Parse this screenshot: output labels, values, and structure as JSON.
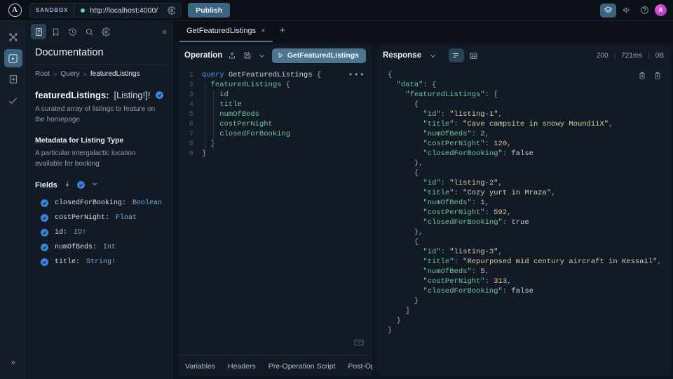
{
  "topbar": {
    "logo": "A",
    "env_chip": "SANDBOX",
    "url": "http://localhost:4000/",
    "publish_label": "Publish",
    "status_color": "#5fd39a",
    "accent_color": "#3c6480",
    "icons": {
      "settings": "gear-icon",
      "eye": "preview-icon",
      "megaphone": "announcements-icon",
      "help": "help-icon"
    },
    "avatar_initial": "A"
  },
  "rail": {
    "items": [
      {
        "name": "graph-icon",
        "active": false
      },
      {
        "name": "explorer-icon",
        "active": true
      },
      {
        "name": "schema-icon",
        "active": false
      },
      {
        "name": "checks-icon",
        "active": false
      }
    ],
    "expand_label": "»"
  },
  "docs": {
    "toolbar": [
      {
        "name": "documentation-icon",
        "active": true
      },
      {
        "name": "bookmark-icon",
        "active": false
      },
      {
        "name": "history-icon",
        "active": false
      },
      {
        "name": "search-icon",
        "active": false
      },
      {
        "name": "settings-icon",
        "active": false
      }
    ],
    "collapse_label": "«",
    "title": "Documentation",
    "breadcrumb": {
      "root": "Root",
      "query": "Query",
      "current": "featuredListings",
      "separator": ">"
    },
    "signature_name": "featuredListings:",
    "signature_type": "[Listing!]!",
    "description": "A curated array of listings to feature on the homepage",
    "metadata_heading": "Metadata for Listing Type",
    "metadata_description": "A particular intergalactic location available for booking",
    "fields_label": "Fields",
    "fields_sort_icon": "arrow-down-icon",
    "fields_chevron": "chevron-down-icon",
    "fields": [
      {
        "name": "closedForBooking:",
        "type": "Boolean"
      },
      {
        "name": "costPerNight:",
        "type": "Float"
      },
      {
        "name": "id:",
        "type": "ID!"
      },
      {
        "name": "numOfBeds:",
        "type": "Int"
      },
      {
        "name": "title:",
        "type": "String!"
      }
    ]
  },
  "tabs": {
    "items": [
      {
        "label": "GetFeaturedListings",
        "close": "×",
        "active": true
      }
    ],
    "new_tab": "+"
  },
  "operation": {
    "title": "Operation",
    "icons": {
      "share": "share-icon",
      "save": "save-icon",
      "chevron": "chevron-down-icon",
      "more": "•••",
      "keyboard": "keyboard-shortcuts-icon"
    },
    "run_label": "GetFeaturedListings",
    "run_icon": "play-icon",
    "lines": [
      {
        "num": "1",
        "segments": [
          {
            "t": "query ",
            "c": "kw"
          },
          {
            "t": "GetFeaturedListings ",
            "c": "fn"
          },
          {
            "t": "{",
            "c": "pun"
          }
        ]
      },
      {
        "num": "2",
        "segments": [
          {
            "t": "  ",
            "c": "pun"
          },
          {
            "t": "featuredListings ",
            "c": "fld"
          },
          {
            "t": "{",
            "c": "pun"
          }
        ]
      },
      {
        "num": "3",
        "segments": [
          {
            "t": "    ",
            "c": "pun"
          },
          {
            "t": "id",
            "c": "fld"
          }
        ]
      },
      {
        "num": "4",
        "segments": [
          {
            "t": "    ",
            "c": "pun"
          },
          {
            "t": "title",
            "c": "fld"
          }
        ]
      },
      {
        "num": "5",
        "segments": [
          {
            "t": "    ",
            "c": "pun"
          },
          {
            "t": "numOfBeds",
            "c": "fld"
          }
        ]
      },
      {
        "num": "6",
        "segments": [
          {
            "t": "    ",
            "c": "pun"
          },
          {
            "t": "costPerNight",
            "c": "fld"
          }
        ]
      },
      {
        "num": "7",
        "segments": [
          {
            "t": "    ",
            "c": "pun"
          },
          {
            "t": "closedForBooking",
            "c": "fld"
          }
        ]
      },
      {
        "num": "8",
        "segments": [
          {
            "t": "  }",
            "c": "pun"
          }
        ]
      },
      {
        "num": "9",
        "segments": [
          {
            "t": "}",
            "c": "pun"
          }
        ]
      }
    ],
    "bottom_tabs": [
      "Variables",
      "Headers",
      "Pre-Operation Script",
      "Post-Ope"
    ]
  },
  "response": {
    "title": "Response",
    "chevron": "chevron-down-icon",
    "view_modes": [
      {
        "name": "json-view-icon",
        "active": true
      },
      {
        "name": "table-view-icon",
        "active": false
      }
    ],
    "status": "200",
    "time": "721ms",
    "size": "0B",
    "actions": [
      "copy-icon",
      "download-icon"
    ],
    "lines": [
      {
        "segments": [
          {
            "t": "{",
            "c": "p"
          }
        ]
      },
      {
        "segments": [
          {
            "t": "  ",
            "c": "p"
          },
          {
            "t": "\"data\"",
            "c": "k"
          },
          {
            "t": ": {",
            "c": "p"
          }
        ]
      },
      {
        "segments": [
          {
            "t": "    ",
            "c": "p"
          },
          {
            "t": "\"featuredListings\"",
            "c": "k"
          },
          {
            "t": ": [",
            "c": "p"
          }
        ]
      },
      {
        "segments": [
          {
            "t": "      {",
            "c": "p"
          }
        ]
      },
      {
        "segments": [
          {
            "t": "        ",
            "c": "p"
          },
          {
            "t": "\"id\"",
            "c": "k"
          },
          {
            "t": ": ",
            "c": "p"
          },
          {
            "t": "\"listing-1\"",
            "c": "s"
          },
          {
            "t": ",",
            "c": "p"
          }
        ]
      },
      {
        "segments": [
          {
            "t": "        ",
            "c": "p"
          },
          {
            "t": "\"title\"",
            "c": "k"
          },
          {
            "t": ": ",
            "c": "p"
          },
          {
            "t": "\"Cave campsite in snowy MoundiiX\"",
            "c": "s"
          },
          {
            "t": ",",
            "c": "p"
          }
        ]
      },
      {
        "segments": [
          {
            "t": "        ",
            "c": "p"
          },
          {
            "t": "\"numOfBeds\"",
            "c": "k"
          },
          {
            "t": ": ",
            "c": "p"
          },
          {
            "t": "2",
            "c": "n"
          },
          {
            "t": ",",
            "c": "p"
          }
        ]
      },
      {
        "segments": [
          {
            "t": "        ",
            "c": "p"
          },
          {
            "t": "\"costPerNight\"",
            "c": "k"
          },
          {
            "t": ": ",
            "c": "p"
          },
          {
            "t": "120",
            "c": "n"
          },
          {
            "t": ",",
            "c": "p"
          }
        ]
      },
      {
        "segments": [
          {
            "t": "        ",
            "c": "p"
          },
          {
            "t": "\"closedForBooking\"",
            "c": "k"
          },
          {
            "t": ": ",
            "c": "p"
          },
          {
            "t": "false",
            "c": "b"
          }
        ]
      },
      {
        "segments": [
          {
            "t": "      },",
            "c": "p"
          }
        ]
      },
      {
        "segments": [
          {
            "t": "      {",
            "c": "p"
          }
        ]
      },
      {
        "segments": [
          {
            "t": "        ",
            "c": "p"
          },
          {
            "t": "\"id\"",
            "c": "k"
          },
          {
            "t": ": ",
            "c": "p"
          },
          {
            "t": "\"listing-2\"",
            "c": "s"
          },
          {
            "t": ",",
            "c": "p"
          }
        ]
      },
      {
        "segments": [
          {
            "t": "        ",
            "c": "p"
          },
          {
            "t": "\"title\"",
            "c": "k"
          },
          {
            "t": ": ",
            "c": "p"
          },
          {
            "t": "\"Cozy yurt in Mraza\"",
            "c": "s"
          },
          {
            "t": ",",
            "c": "p"
          }
        ]
      },
      {
        "segments": [
          {
            "t": "        ",
            "c": "p"
          },
          {
            "t": "\"numOfBeds\"",
            "c": "k"
          },
          {
            "t": ": ",
            "c": "p"
          },
          {
            "t": "1",
            "c": "n"
          },
          {
            "t": ",",
            "c": "p"
          }
        ]
      },
      {
        "segments": [
          {
            "t": "        ",
            "c": "p"
          },
          {
            "t": "\"costPerNight\"",
            "c": "k"
          },
          {
            "t": ": ",
            "c": "p"
          },
          {
            "t": "592",
            "c": "n"
          },
          {
            "t": ",",
            "c": "p"
          }
        ]
      },
      {
        "segments": [
          {
            "t": "        ",
            "c": "p"
          },
          {
            "t": "\"closedForBooking\"",
            "c": "k"
          },
          {
            "t": ": ",
            "c": "p"
          },
          {
            "t": "true",
            "c": "b"
          }
        ]
      },
      {
        "segments": [
          {
            "t": "      },",
            "c": "p"
          }
        ]
      },
      {
        "segments": [
          {
            "t": "      {",
            "c": "p"
          }
        ]
      },
      {
        "segments": [
          {
            "t": "        ",
            "c": "p"
          },
          {
            "t": "\"id\"",
            "c": "k"
          },
          {
            "t": ": ",
            "c": "p"
          },
          {
            "t": "\"listing-3\"",
            "c": "s"
          },
          {
            "t": ",",
            "c": "p"
          }
        ]
      },
      {
        "segments": [
          {
            "t": "        ",
            "c": "p"
          },
          {
            "t": "\"title\"",
            "c": "k"
          },
          {
            "t": ": ",
            "c": "p"
          },
          {
            "t": "\"Repurposed mid century aircraft in Kessail\"",
            "c": "s"
          },
          {
            "t": ",",
            "c": "p"
          }
        ]
      },
      {
        "segments": [
          {
            "t": "        ",
            "c": "p"
          },
          {
            "t": "\"numOfBeds\"",
            "c": "k"
          },
          {
            "t": ": ",
            "c": "p"
          },
          {
            "t": "5",
            "c": "n"
          },
          {
            "t": ",",
            "c": "p"
          }
        ]
      },
      {
        "segments": [
          {
            "t": "        ",
            "c": "p"
          },
          {
            "t": "\"costPerNight\"",
            "c": "k"
          },
          {
            "t": ": ",
            "c": "p"
          },
          {
            "t": "313",
            "c": "n"
          },
          {
            "t": ",",
            "c": "p"
          }
        ]
      },
      {
        "segments": [
          {
            "t": "        ",
            "c": "p"
          },
          {
            "t": "\"closedForBooking\"",
            "c": "k"
          },
          {
            "t": ": ",
            "c": "p"
          },
          {
            "t": "false",
            "c": "b"
          }
        ]
      },
      {
        "segments": [
          {
            "t": "      }",
            "c": "p"
          }
        ]
      },
      {
        "segments": [
          {
            "t": "    ]",
            "c": "p"
          }
        ]
      },
      {
        "segments": [
          {
            "t": "  }",
            "c": "p"
          }
        ]
      },
      {
        "segments": [
          {
            "t": "}",
            "c": "p"
          }
        ]
      }
    ]
  }
}
